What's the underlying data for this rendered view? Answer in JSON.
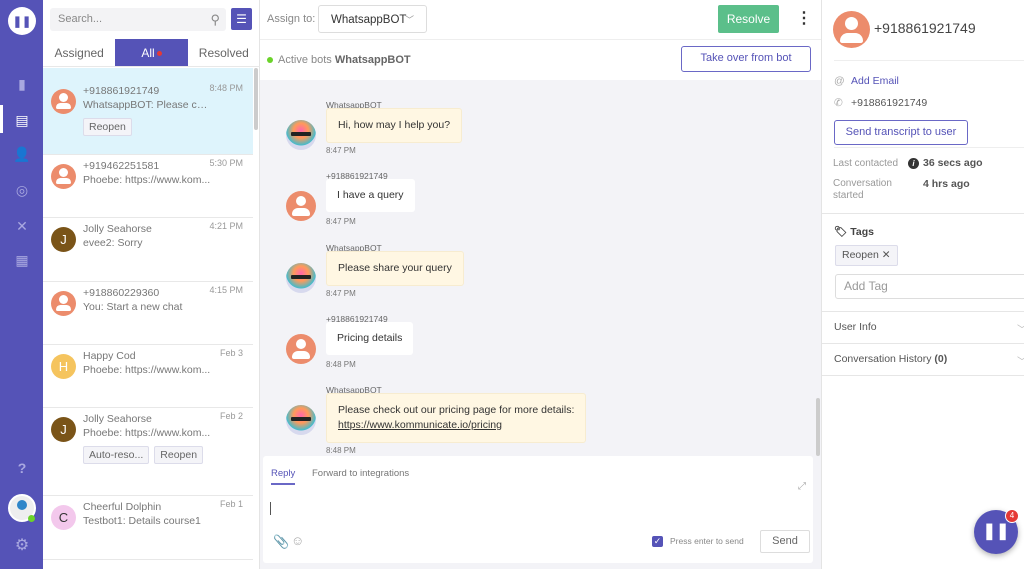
{
  "nav": {
    "items": [
      {
        "icon": "reports-icon",
        "glyph": "▮"
      },
      {
        "icon": "conversations-icon",
        "glyph": "▤"
      },
      {
        "icon": "users-icon",
        "glyph": "👤"
      },
      {
        "icon": "bot-icon",
        "glyph": "◎"
      },
      {
        "icon": "integrations-icon",
        "glyph": "✕"
      },
      {
        "icon": "knowledge-base-icon",
        "glyph": "▦"
      }
    ],
    "help_glyph": "?",
    "settings_glyph": "⚙"
  },
  "list": {
    "search_placeholder": "Search...",
    "tabs": [
      "Assigned",
      "All",
      "Resolved"
    ],
    "items": [
      {
        "name": "+918861921749",
        "message": "WhatsappBOT: Please che...",
        "time": "8:48 PM",
        "avatar": "person",
        "chips": [
          "Reopen"
        ],
        "selected": true
      },
      {
        "name": "+919462251581",
        "message": "Phoebe: https://www.kom...",
        "time": "5:30 PM",
        "avatar": "person",
        "chips": []
      },
      {
        "name": "Jolly Seahorse",
        "message": "evee2: Sorry",
        "time": "4:21 PM",
        "avatar": "J",
        "avatar_color": "#7a5418",
        "chips": []
      },
      {
        "name": "+918860229360",
        "message": "You: Start a new chat",
        "time": "4:15 PM",
        "avatar": "person",
        "chips": []
      },
      {
        "name": "Happy Cod",
        "message": "Phoebe: https://www.kom...",
        "time": "Feb 3",
        "avatar": "H",
        "avatar_color": "#f5c45e",
        "chips": []
      },
      {
        "name": "Jolly Seahorse",
        "message": "Phoebe: https://www.kom...",
        "time": "Feb 2",
        "avatar": "J",
        "avatar_color": "#7a5418",
        "chips": [
          "Auto-reso...",
          "Reopen"
        ]
      },
      {
        "name": "Cheerful Dolphin",
        "message": "Testbot1: Details course1",
        "time": "Feb 1",
        "avatar": "C",
        "avatar_color": "#f3c8ec",
        "chips": []
      }
    ]
  },
  "chat": {
    "assign_label": "Assign to:",
    "assignee": "WhatsappBOT",
    "resolve_label": "Resolve",
    "active_bots_label": "Active bots",
    "active_bot": "WhatsappBOT",
    "takeover_label": "Take over from bot",
    "messages": [
      {
        "sender": "WhatsappBOT",
        "type": "bot",
        "text": "Hi, how may I help you?",
        "time": "8:47 PM"
      },
      {
        "sender": "+918861921749",
        "type": "user",
        "text": "I have a query",
        "time": "8:47 PM"
      },
      {
        "sender": "WhatsappBOT",
        "type": "bot",
        "text": "Please share your query",
        "time": "8:47 PM"
      },
      {
        "sender": "+918861921749",
        "type": "user",
        "text": "Pricing details",
        "time": "8:48 PM"
      },
      {
        "sender": "WhatsappBOT",
        "type": "bot",
        "text": "Please check out our pricing page for more details:",
        "link": "https://www.kommunicate.io/pricing",
        "time": "8:48 PM"
      }
    ],
    "composer": {
      "tabs": [
        "Reply",
        "Forward to integrations"
      ],
      "value": "",
      "press_enter_label": "Press enter to send",
      "press_enter_checked": true,
      "send_label": "Send"
    }
  },
  "profile": {
    "name": "+918861921749",
    "add_email": "Add Email",
    "phone": "+918861921749",
    "transcript_label": "Send transcript to user",
    "last_contacted_label": "Last contacted",
    "last_contacted": "36 secs ago",
    "started_label": "Conversation started",
    "started": "4 hrs ago",
    "tags_label": "Tags",
    "tags": [
      "Reopen"
    ],
    "add_tag_placeholder": "Add Tag",
    "user_info_label": "User Info",
    "history_label": "Conversation History",
    "history_count": "(0)"
  },
  "widget": {
    "badge": "4"
  },
  "colors": {
    "brand": "#5553b7",
    "resolve": "#5bbf8a",
    "selected": "#def4fc",
    "bot_bubble": "#fff7e3"
  }
}
